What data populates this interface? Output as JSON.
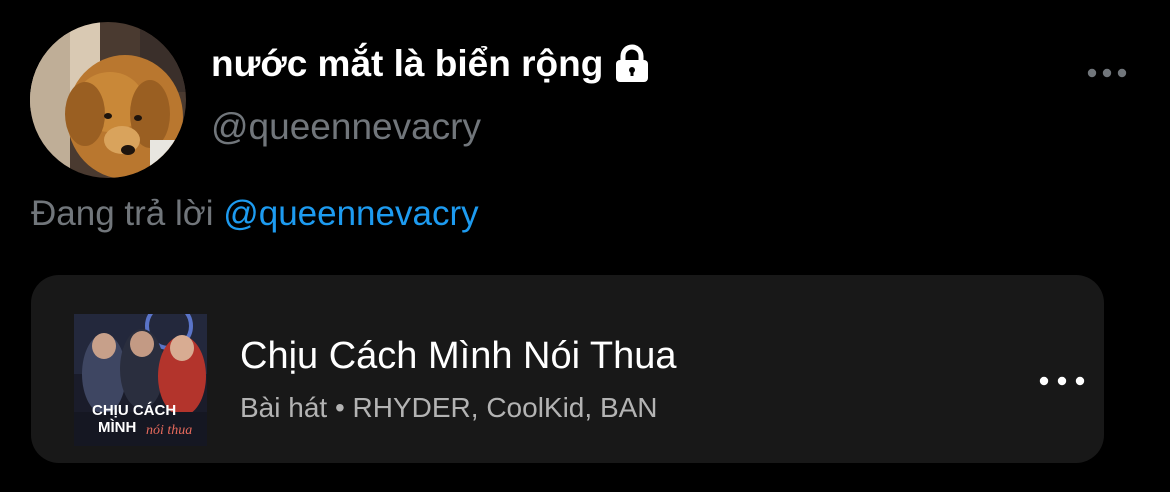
{
  "profile": {
    "display_name": "nước mắt là biển rộng",
    "handle": "@queennevacry",
    "avatar_icon": "dog-avatar",
    "locked_icon": "lock-icon",
    "more_icon": "more-horizontal-icon"
  },
  "reply": {
    "prefix": "Đang trả lời",
    "mention": "@queennevacry"
  },
  "song": {
    "title": "Chịu Cách Mình Nói Thua",
    "subtitle": "Bài hát • RHYDER, CoolKid, BAN",
    "cover_icon": "album-cover",
    "cover_text_line1": "CHỊU CÁCH",
    "cover_text_line2": "MÌNH",
    "cover_text_script": "nói thua",
    "more_icon": "more-horizontal-icon"
  },
  "colors": {
    "background": "#000000",
    "text_primary": "#ffffff",
    "text_secondary": "#71767b",
    "link": "#1d9bf0",
    "card_background": "#181818"
  }
}
